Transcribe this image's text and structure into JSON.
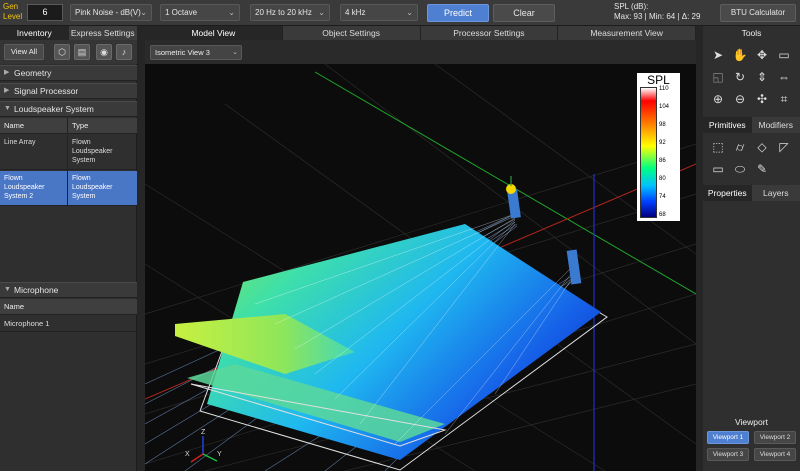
{
  "toolbar": {
    "gen_label_1": "Gen",
    "gen_label_2": "Level",
    "gen_value": "6",
    "signal": "Pink Noise - dB(V)",
    "bandwidth": "1 Octave",
    "range": "20 Hz to 20 kHz",
    "frequency": "4 kHz",
    "predict": "Predict",
    "clear": "Clear",
    "spl_label": "SPL (dB):",
    "spl_stats": "Max: 93  |  Min: 64  |  Δ: 29",
    "btu": "BTU Calculator"
  },
  "left": {
    "tabs": [
      "Inventory",
      "Express Settings"
    ],
    "view_all": "View All",
    "sections": {
      "geometry": "Geometry",
      "signal_processor": "Signal Processor",
      "loudspeaker_system": "Loudspeaker System",
      "microphone": "Microphone"
    },
    "ls_table": {
      "headers": [
        "Name",
        "Type"
      ],
      "rows": [
        {
          "name": "Line Array",
          "type": "Flown Loudspeaker System"
        },
        {
          "name": "Flown Loudspeaker System 2",
          "type": "Flown Loudspeaker System"
        }
      ]
    },
    "mic_table": {
      "header": "Name",
      "rows": [
        "Microphone 1"
      ]
    }
  },
  "center": {
    "tabs": [
      "Model View",
      "Object Settings",
      "Processor Settings",
      "Measurement View"
    ],
    "view_select": "Isometric View 3",
    "spl_title": "SPL",
    "spl_ticks": [
      "110",
      "104",
      "98",
      "92",
      "86",
      "80",
      "74",
      "68"
    ],
    "axes": {
      "x": "X",
      "y": "Y",
      "z": "Z"
    }
  },
  "right": {
    "tools_title": "Tools",
    "tabs1": [
      "Primitives",
      "Modifiers"
    ],
    "tabs2": [
      "Properties",
      "Layers"
    ],
    "viewport_title": "Viewport",
    "viewports": [
      "Viewport 1",
      "Viewport 2",
      "Viewport 3",
      "Viewport 4"
    ]
  },
  "colors": {
    "accent": "#4f7fd0",
    "gen_label": "#f1c40f"
  }
}
